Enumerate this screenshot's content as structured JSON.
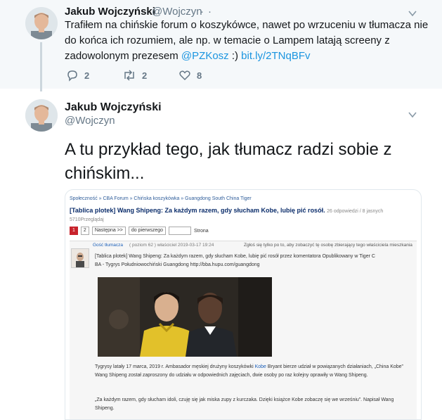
{
  "tweet1": {
    "name": "Jakub Wojczyński",
    "handle": "@Wojczyn",
    "separator": "·",
    "time": "·",
    "text_before": "Trafiłem na chińskie forum o koszykówce, nawet po wrzuceniu w tłumacza nie do końca ich rozumiem, ale np. w temacie o Lampem latają screeny z zadowolonym prezesem ",
    "mention": "@PZKosz",
    "text_mid": " :) ",
    "link": "bit.ly/2TNqBFv",
    "replies": "2",
    "retweets": "2",
    "likes": "8"
  },
  "tweet2": {
    "name": "Jakub Wojczyński",
    "handle": "@Wojczyn",
    "text": "A tu przykład tego, jak tłumacz radzi sobie z chińskim..."
  },
  "screenshot": {
    "breadcrumb": "Społeczność » CBA Forum » Chińska koszykówka » Guangdong South China Tiger",
    "title": "[Tablica plotek] Wang Shipeng: Za każdym razem, gdy słucham Kobe, lubię pić rosół.",
    "title_meta": "26 odpowiedzi / 8 jasnych 5710Przeglądaj",
    "pager": {
      "page1": "1",
      "page2": "2",
      "next": "Następna >>",
      "first": "do pierwszego",
      "page_word": "Strona"
    },
    "post": {
      "user": "Gość tłumacza",
      "user_meta": "( poziom 62 )  właściciel  2019-03-17 19:24",
      "actions": "Zgłoś się   tylko po to, aby zobaczyć tę osobę   zbierający tego   właściciela mieszkania",
      "line1": "[Tablica plotek] Wang Shipeng: Za każdym razem, gdy słucham Kobe, lubię pić rosół   przez komentatora Opublikowany w Tiger C",
      "line2": "BA - Tygrys Południowochiński Guangdong http://bba.hupu.com/guangdong",
      "p1_before": "Tygrysy latały 17 marca, 2019 r. Ambasador męskiej drużyny koszykówki ",
      "p1_link": "Kobe",
      "p1_after": " Bryant bierze udział w powiązanych działaniach, „China Kobe” Wang Shipeng został zaproszony do udziału w odpowiednich zajęciach, dwie osoby po raz kolejny oprawiły w Wang Shipeng.",
      "p2": "„Za każdym razem, gdy słucham idoli, czuję się jak miska zupy z kurczaka. Dzięki książce Kobe zobaczę się we wrześniu”. Napisał Wang Shipeng."
    }
  },
  "colors": {
    "accent": "#1b95e0",
    "muted": "#657786",
    "thread_bg": "#f5f8fa"
  },
  "icons": [
    "reply-icon",
    "retweet-icon",
    "like-icon",
    "chevron-down-icon"
  ]
}
